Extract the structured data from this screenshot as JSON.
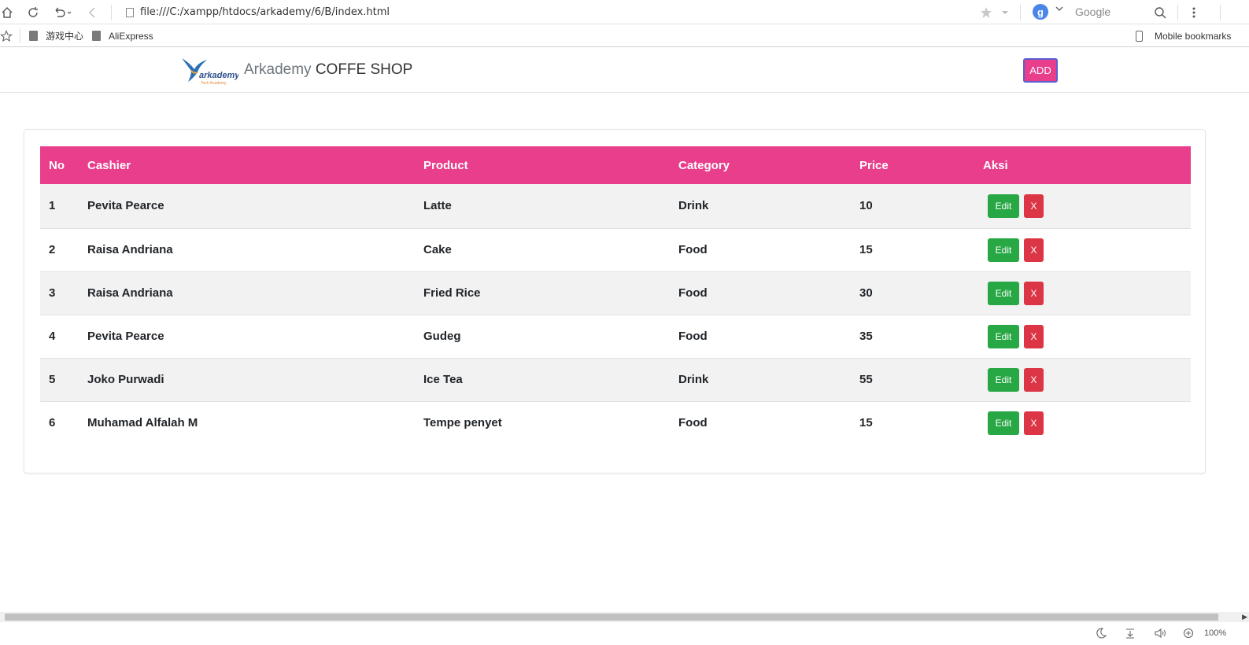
{
  "browser": {
    "url": "file:///C:/xampp/htdocs/arkademy/6/B/index.html",
    "search_engine_letter": "g",
    "search_placeholder": "Google",
    "bookmarks": [
      "游戏中心",
      "AliExpress"
    ],
    "mobile_bookmarks": "Mobile bookmarks",
    "zoom": "100%"
  },
  "navbar": {
    "brand_light": "Arkademy",
    "brand_dark": "COFFE SHOP",
    "add_label": "ADD",
    "logo_text": "arkademy",
    "logo_subtext": "Tech Academy"
  },
  "table": {
    "headers": [
      "No",
      "Cashier",
      "Product",
      "Category",
      "Price",
      "Aksi"
    ],
    "rows": [
      {
        "no": "1",
        "cashier": "Pevita Pearce",
        "product": "Latte",
        "category": "Drink",
        "price": "10"
      },
      {
        "no": "2",
        "cashier": "Raisa Andriana",
        "product": "Cake",
        "category": "Food",
        "price": "15"
      },
      {
        "no": "3",
        "cashier": "Raisa Andriana",
        "product": "Fried Rice",
        "category": "Food",
        "price": "30"
      },
      {
        "no": "4",
        "cashier": "Pevita Pearce",
        "product": "Gudeg",
        "category": "Food",
        "price": "35"
      },
      {
        "no": "5",
        "cashier": "Joko Purwadi",
        "product": "Ice Tea",
        "category": "Drink",
        "price": "55"
      },
      {
        "no": "6",
        "cashier": "Muhamad Alfalah M",
        "product": "Tempe penyet",
        "category": "Food",
        "price": "15"
      }
    ],
    "edit_label": "Edit",
    "delete_label": "X"
  },
  "colors": {
    "accent_pink": "#e83e8c",
    "edit_green": "#28a745",
    "delete_red": "#dc3545"
  }
}
